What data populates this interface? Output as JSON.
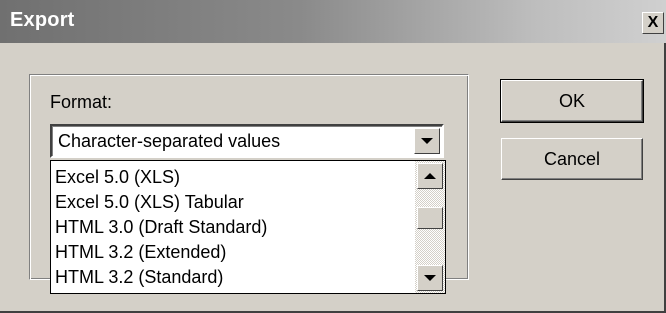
{
  "window": {
    "title": "Export",
    "close_glyph": "X"
  },
  "format": {
    "label": "Format:",
    "selected": "Character-separated values",
    "options": [
      "Excel 5.0 (XLS)",
      "Excel 5.0 (XLS) Tabular",
      "HTML 3.0 (Draft Standard)",
      "HTML 3.2 (Extended)",
      "HTML 3.2 (Standard)"
    ]
  },
  "buttons": {
    "ok": "OK",
    "cancel": "Cancel"
  },
  "icons": {
    "close": "close-icon",
    "dropdown": "chevron-down-icon",
    "scroll_up": "chevron-up-icon",
    "scroll_down": "chevron-down-icon"
  }
}
